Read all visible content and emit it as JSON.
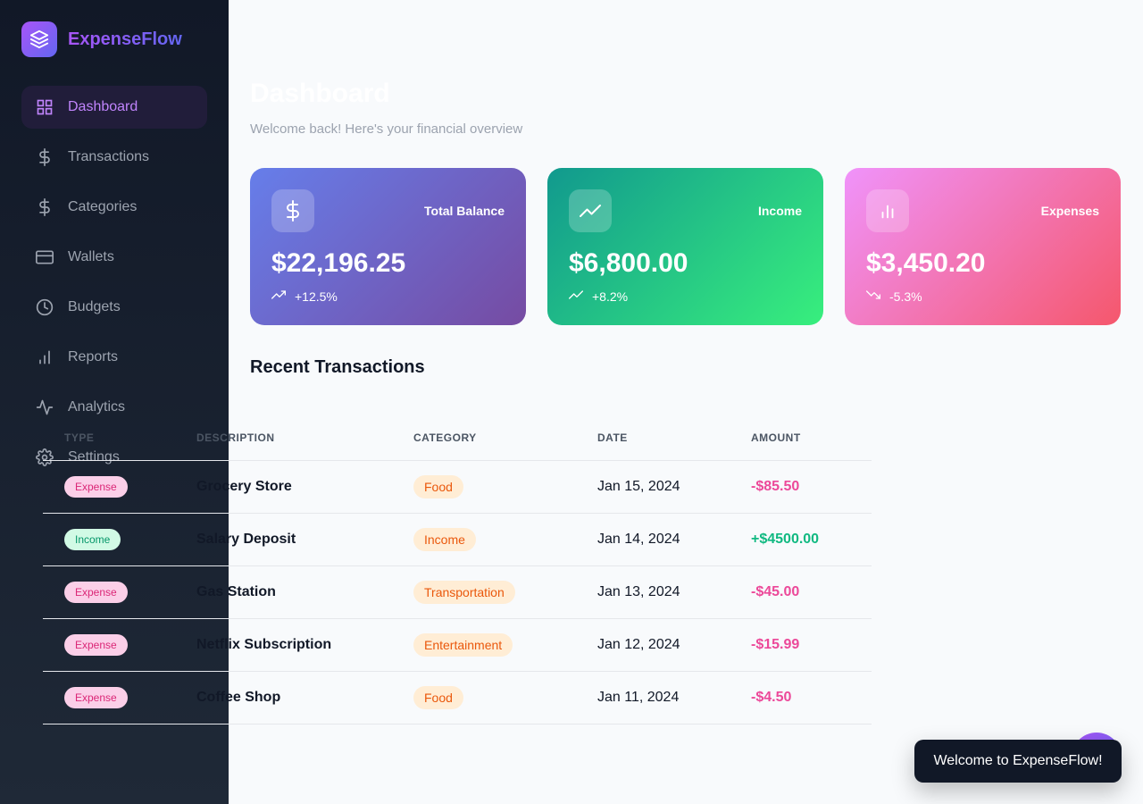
{
  "app": {
    "name": "ExpenseFlow"
  },
  "sidebar": {
    "items": [
      {
        "label": "Dashboard",
        "icon": "grid-icon",
        "active": true
      },
      {
        "label": "Transactions",
        "icon": "dollar-icon"
      },
      {
        "label": "Categories",
        "icon": "dollar-icon"
      },
      {
        "label": "Wallets",
        "icon": "credit-card-icon"
      },
      {
        "label": "Budgets",
        "icon": "clock-icon"
      },
      {
        "label": "Reports",
        "icon": "bar-chart-icon"
      },
      {
        "label": "Analytics",
        "icon": "activity-icon"
      },
      {
        "label": "Settings",
        "icon": "gear-icon"
      }
    ]
  },
  "header": {
    "title": "Dashboard",
    "subtitle": "Welcome back! Here's your financial overview"
  },
  "cards": [
    {
      "label": "Total Balance",
      "value": "$22,196.25",
      "trend": "+12.5%",
      "icon": "dollar-icon",
      "trend_icon": "trending-up-icon"
    },
    {
      "label": "Income",
      "value": "$6,800.00",
      "trend": "+8.2%",
      "icon": "trending-up-icon",
      "trend_icon": "trending-up-icon"
    },
    {
      "label": "Expenses",
      "value": "$3,450.20",
      "trend": "-5.3%",
      "icon": "bar-chart-icon",
      "trend_icon": "trending-down-icon"
    }
  ],
  "transactions": {
    "title": "Recent Transactions",
    "columns": [
      "TYPE",
      "DESCRIPTION",
      "CATEGORY",
      "DATE",
      "AMOUNT"
    ],
    "rows": [
      {
        "type": "Expense",
        "description": "Grocery Store",
        "category": "Food",
        "date": "Jan 15, 2024",
        "amount": "-$85.50"
      },
      {
        "type": "Income",
        "description": "Salary Deposit",
        "category": "Income",
        "date": "Jan 14, 2024",
        "amount": "+$4500.00"
      },
      {
        "type": "Expense",
        "description": "Gas Station",
        "category": "Transportation",
        "date": "Jan 13, 2024",
        "amount": "-$45.00"
      },
      {
        "type": "Expense",
        "description": "Netflix Subscription",
        "category": "Entertainment",
        "date": "Jan 12, 2024",
        "amount": "-$15.99"
      },
      {
        "type": "Expense",
        "description": "Coffee Shop",
        "category": "Food",
        "date": "Jan 11, 2024",
        "amount": "-$4.50"
      }
    ]
  },
  "toast": {
    "message": "Welcome to ExpenseFlow!"
  },
  "colors": {
    "accent": "#a855f7",
    "sidebar_bg": "#111827",
    "expense": "#ec4899",
    "income": "#10b981",
    "category": "#ea580c"
  }
}
